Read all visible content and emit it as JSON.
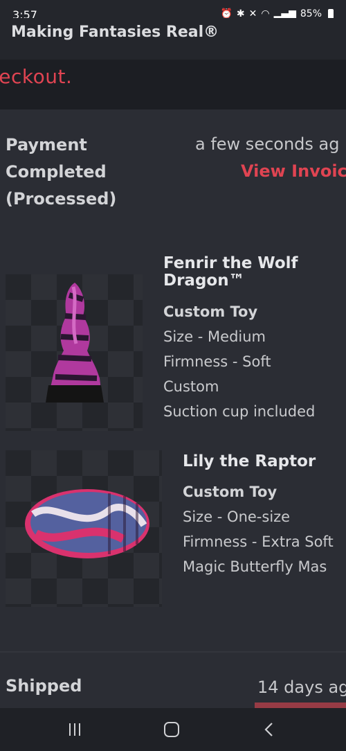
{
  "status_bar": {
    "time": "3:57",
    "battery": "85%",
    "icons": [
      "alarm-icon",
      "bluetooth-icon",
      "mute-icon",
      "wifi-icon",
      "signal-icon",
      "battery-icon"
    ]
  },
  "header": {
    "brand": "Making Fantasies Real®",
    "checkout_text": "neckout."
  },
  "events": [
    {
      "status_lines": [
        "Payment",
        "Completed",
        "(Processed)"
      ],
      "time": "a few seconds ag",
      "link": "View Invoic"
    },
    {
      "status_lines": [
        "Shipped"
      ],
      "time": "14 days ag"
    }
  ],
  "products": [
    {
      "name_lines": [
        "Fenrir the Wolf",
        "Dragon™"
      ],
      "type": "Custom Toy",
      "attributes": [
        "Size - Medium",
        "Firmness - Soft",
        "Custom",
        "Suction cup included"
      ],
      "colors": [
        "#b0399e",
        "#2a1630",
        "#d46ac4"
      ]
    },
    {
      "name_lines": [
        "Lily the Raptor"
      ],
      "type": "Custom Toy",
      "attributes": [
        "Size - One-size",
        "Firmness - Extra Soft",
        "Magic Butterfly Mas"
      ],
      "colors": [
        "#d9326e",
        "#3c6aa8",
        "#e8e0ea"
      ]
    }
  ],
  "accent_color": "#e04452"
}
